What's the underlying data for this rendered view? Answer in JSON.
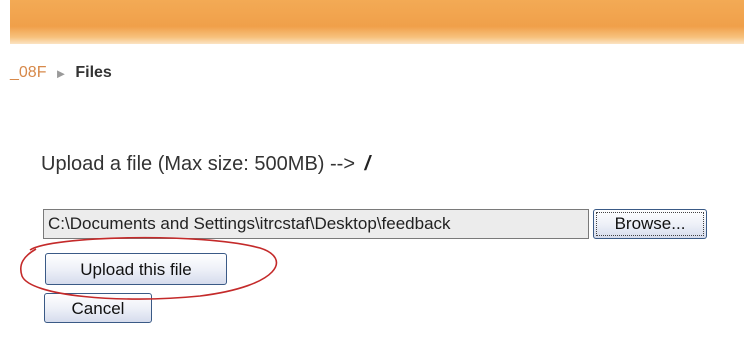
{
  "breadcrumb": {
    "course": "_08F",
    "separator": "►",
    "current": "Files"
  },
  "upload": {
    "title": "Upload a file (Max size: 500MB) -->",
    "help_glyph": "/",
    "file_path_value": "C:\\Documents and Settings\\itrcstaf\\Desktop\\feedback",
    "browse_label": "Browse...",
    "upload_label": "Upload this file",
    "cancel_label": "Cancel"
  },
  "colors": {
    "header_orange": "#f0a04a",
    "annotation_red": "#c42a2a"
  },
  "icons": {
    "breadcrumb_separator": "triangle-right-icon",
    "help": "help-icon"
  }
}
